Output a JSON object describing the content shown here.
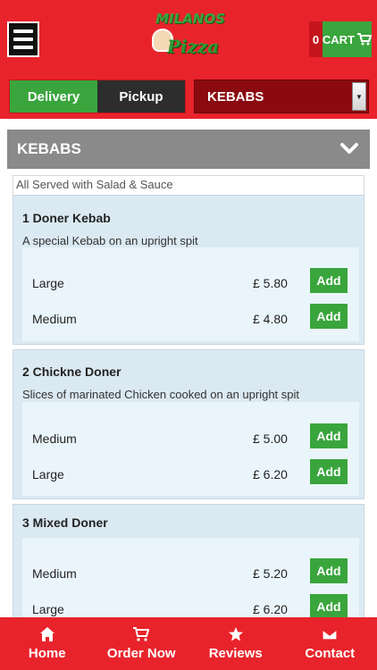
{
  "header": {
    "logo_top": "MILANOS",
    "logo_bottom": "Pizza",
    "cart_count": "0",
    "cart_label": "CART"
  },
  "toolbar": {
    "delivery_label": "Delivery",
    "pickup_label": "Pickup",
    "category_select": "KEBABS"
  },
  "category": {
    "title": "KEBABS",
    "note": "All Served with Salad & Sauce"
  },
  "items": [
    {
      "title": "1 Doner Kebab",
      "desc": "A special Kebab on an upright spit",
      "options": [
        {
          "size": "Large",
          "price": "£ 5.80",
          "add": "Add"
        },
        {
          "size": "Medium",
          "price": "£ 4.80",
          "add": "Add"
        }
      ]
    },
    {
      "title": "2 Chickne Doner",
      "desc": "Slices of marinated Chicken cooked on an upright spit",
      "options": [
        {
          "size": "Medium",
          "price": "£ 5.00",
          "add": "Add"
        },
        {
          "size": "Large",
          "price": "£ 6.20",
          "add": "Add"
        }
      ]
    },
    {
      "title": "3 Mixed Doner",
      "desc": "",
      "options": [
        {
          "size": "Medium",
          "price": "£ 5.20",
          "add": "Add"
        },
        {
          "size": "Large",
          "price": "£ 6.20",
          "add": "Add"
        }
      ]
    }
  ],
  "nav": [
    {
      "label": "Home",
      "icon": "home-icon"
    },
    {
      "label": "Order Now",
      "icon": "cart-icon"
    },
    {
      "label": "Reviews",
      "icon": "star-icon"
    },
    {
      "label": "Contact",
      "icon": "envelope-icon"
    }
  ],
  "colors": {
    "brand_red": "#e8232b",
    "accent_green": "#3aa53d",
    "dark_red": "#8b0a10",
    "card_blue": "#dbe9f2"
  }
}
